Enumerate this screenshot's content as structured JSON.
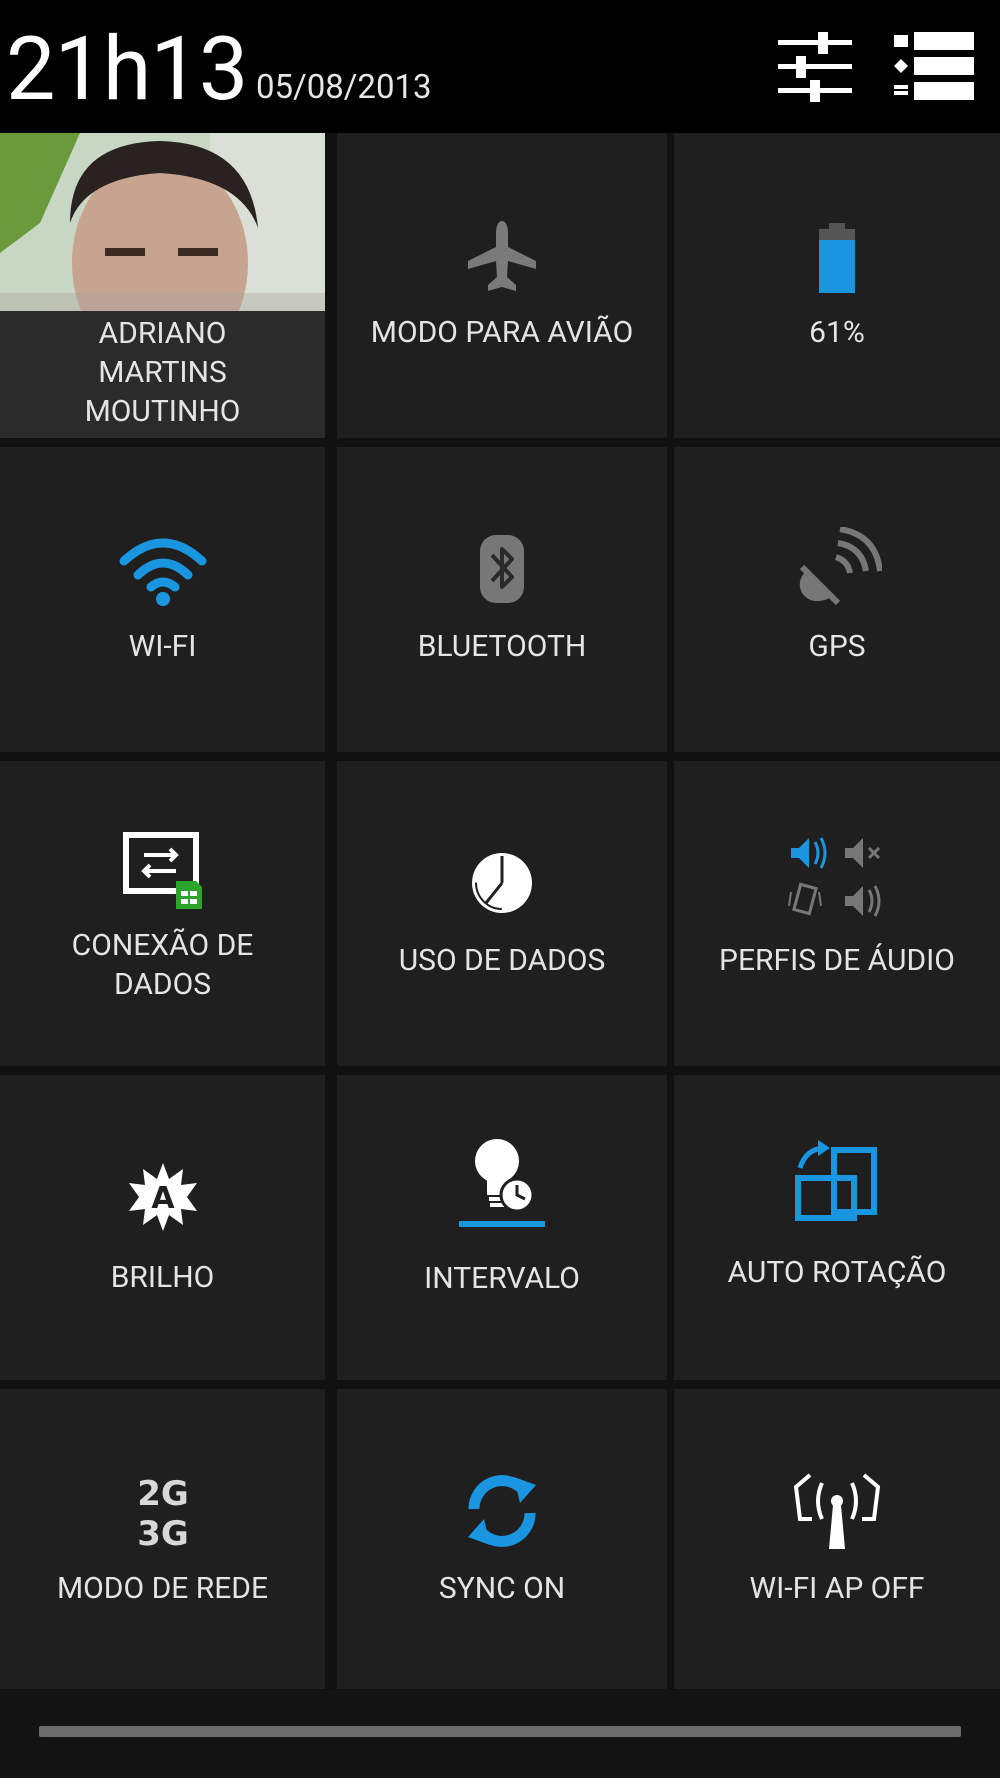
{
  "statusbar": {
    "time": "21h13",
    "date": "05/08/2013"
  },
  "user": {
    "name": "ADRIANO MARTINS MOUTINHO"
  },
  "tiles": [
    {
      "label": "MODO PARA AVIÃO"
    },
    {
      "label": "61%",
      "value": 61
    },
    {
      "label": "WI-FI"
    },
    {
      "label": "BLUETOOTH"
    },
    {
      "label": "GPS"
    },
    {
      "label": "CONEXÃO DE DADOS"
    },
    {
      "label": "USO DE DADOS"
    },
    {
      "label": "PERFIS DE ÁUDIO"
    },
    {
      "label": "BRILHO"
    },
    {
      "label": "INTERVALO"
    },
    {
      "label": "AUTO ROTAÇÃO"
    },
    {
      "label": "MODO DE REDE"
    },
    {
      "label": "SYNC ON"
    },
    {
      "label": "WI-FI AP OFF"
    }
  ],
  "icons": {
    "settings": "settings-sliders-icon",
    "list": "notifications-list-icon",
    "network_mode_text": "2G 3G"
  },
  "colors": {
    "accent": "#1a96e0",
    "inactive": "#777777",
    "data_sim": "#2ca52c"
  }
}
